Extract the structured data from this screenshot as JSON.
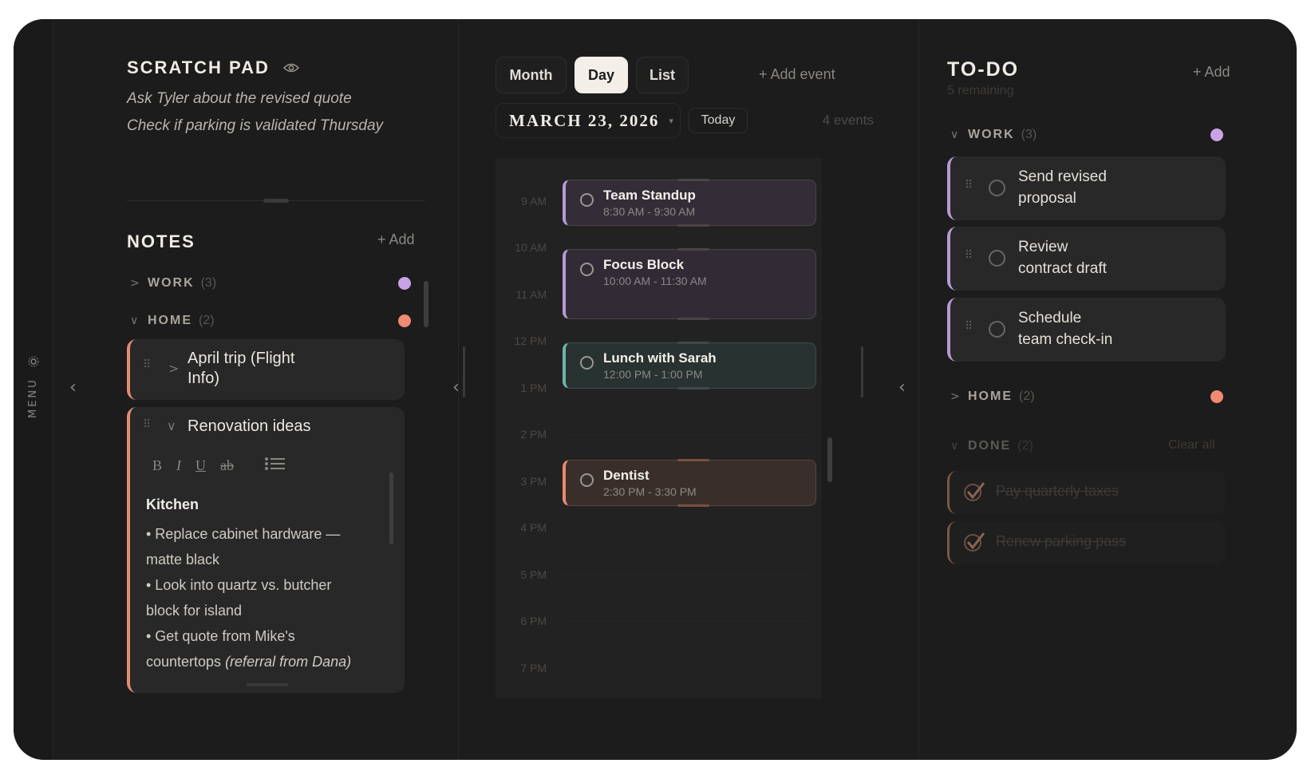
{
  "menu": {
    "label": "MENU"
  },
  "scratch_pad": {
    "title": "SCRATCH PAD",
    "lines": [
      "Ask Tyler about the revised quote",
      "Check if parking is validated Thursday"
    ]
  },
  "notes": {
    "title": "NOTES",
    "add_label": "+ Add",
    "groups": [
      {
        "name": "WORK",
        "count": "(3)",
        "color": "#c9a3e6"
      },
      {
        "name": "HOME",
        "count": "(2)",
        "color": "#f08a72"
      }
    ],
    "items": [
      {
        "title_line1": "April trip (Flight",
        "title_line2": "Info)"
      },
      {
        "title": "Renovation ideas",
        "toolbar": {
          "bold": "B",
          "italic": "I",
          "underline": "U",
          "strike": "ab"
        },
        "body": {
          "heading": "Kitchen",
          "line1": "• Replace cabinet hardware —",
          "line2": "matte black",
          "line3": "• Look into quartz vs. butcher",
          "line4": "block for island",
          "line5": "• Get quote from Mike's",
          "line6_plain": "countertops ",
          "line6_italic": "(referral from Dana)"
        }
      }
    ]
  },
  "calendar": {
    "views": {
      "month": "Month",
      "day": "Day",
      "list": "List"
    },
    "active_view": "Day",
    "add_event_label": "+ Add event",
    "date": "MARCH 23, 2026",
    "today_label": "Today",
    "events_count": "4 events",
    "hours": [
      "9 AM",
      "10 AM",
      "11 AM",
      "12 PM",
      "1 PM",
      "2 PM",
      "3 PM",
      "4 PM",
      "5 PM",
      "6 PM",
      "7 PM"
    ],
    "events": [
      {
        "title": "Team Standup",
        "time": "8:30 AM - 9:30 AM",
        "color": "#b79ad6"
      },
      {
        "title": "Focus Block",
        "time": "10:00 AM - 11:30 AM",
        "color": "#b79ad6"
      },
      {
        "title": "Lunch with Sarah",
        "time": "12:00 PM - 1:00 PM",
        "color": "#6fb3a8"
      },
      {
        "title": "Dentist",
        "time": "2:30 PM - 3:30 PM",
        "color": "#e58b72"
      }
    ]
  },
  "todo": {
    "title": "TO-DO",
    "remaining": "5 remaining",
    "add_label": "+ Add",
    "groups": [
      {
        "name": "WORK",
        "count": "(3)",
        "color": "#c9a3e6"
      },
      {
        "name": "HOME",
        "count": "(2)",
        "color": "#f08a72"
      },
      {
        "name": "DONE",
        "count": "(2)"
      }
    ],
    "work_items": [
      {
        "line1": "Send revised",
        "line2": "proposal"
      },
      {
        "line1": "Review",
        "line2": "contract draft"
      },
      {
        "line1": "Schedule",
        "line2": "team check-in"
      }
    ],
    "clear_all_label": "Clear all",
    "done_items": [
      "Pay quarterly taxes",
      "Renew parking pass"
    ]
  }
}
